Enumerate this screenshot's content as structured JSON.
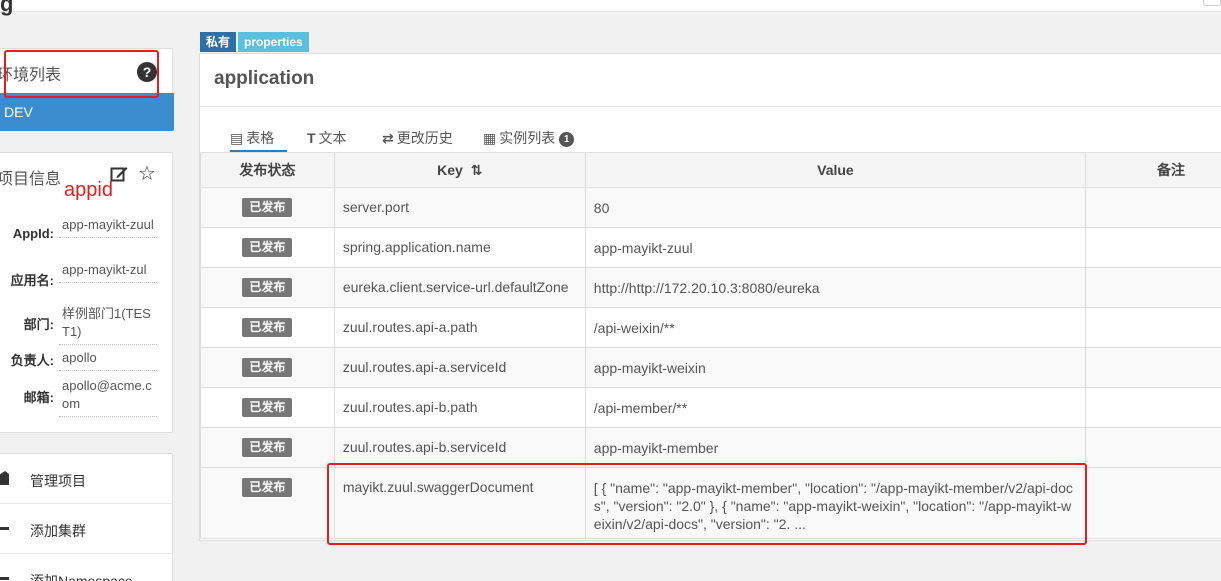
{
  "topbar": {
    "logo_text": "g"
  },
  "env": {
    "title": "环境列表",
    "help_icon": "question-circle-icon",
    "items": [
      {
        "label": "DEV"
      }
    ]
  },
  "project": {
    "title": "项目信息",
    "annotation": "appid",
    "fields": [
      {
        "label": "AppId:",
        "value": "app-mayikt-zuul"
      },
      {
        "label": "应用名:",
        "value": "app-mayikt-zul"
      },
      {
        "label": "部门:",
        "value": "样例部门1(TEST1)"
      },
      {
        "label": "负责人:",
        "value": "apollo"
      },
      {
        "label": "邮箱:",
        "value": "apollo@acme.com"
      }
    ]
  },
  "menu": {
    "items": [
      {
        "label": "管理项目",
        "icon": "manage-icon"
      },
      {
        "label": "添加集群",
        "icon": "add-cluster-icon"
      },
      {
        "label": "添加Namespace",
        "icon": "add-namespace-icon"
      }
    ]
  },
  "namespace": {
    "tags": [
      "私有",
      "properties"
    ],
    "title": "application",
    "tabs": [
      {
        "label": "表格",
        "icon": "table-icon",
        "glyph": "▤"
      },
      {
        "label": "文本",
        "icon": "text-icon",
        "glyph": "T"
      },
      {
        "label": "更改历史",
        "icon": "history-icon",
        "glyph": "⇄"
      },
      {
        "label": "实例列表",
        "icon": "instances-icon",
        "glyph": "▦",
        "badge": "1"
      }
    ],
    "table": {
      "headers": {
        "status": "发布状态",
        "key": "Key",
        "sort_icon": "sort-icon",
        "value": "Value",
        "comment": "备注"
      },
      "rows": [
        {
          "status": "已发布",
          "key": "server.port",
          "value": "80"
        },
        {
          "status": "已发布",
          "key": "spring.application.name",
          "value": "app-mayikt-zuul"
        },
        {
          "status": "已发布",
          "key": "eureka.client.service-url.defaultZone",
          "value": "http://http://172.20.10.3:8080/eureka"
        },
        {
          "status": "已发布",
          "key": "zuul.routes.api-a.path",
          "value": "/api-weixin/**"
        },
        {
          "status": "已发布",
          "key": "zuul.routes.api-a.serviceId",
          "value": "app-mayikt-weixin"
        },
        {
          "status": "已发布",
          "key": "zuul.routes.api-b.path",
          "value": "/api-member/**"
        },
        {
          "status": "已发布",
          "key": "zuul.routes.api-b.serviceId",
          "value": "app-mayikt-member"
        },
        {
          "status": "已发布",
          "key": "mayikt.zuul.swaggerDocument",
          "value": "[ { \"name\": \"app-mayikt-member\", \"location\": \"/app-mayikt-member/v2/api-docs\", \"version\": \"2.0\" }, { \"name\": \"app-mayikt-weixin\", \"location\": \"/app-mayikt-weixin/v2/api-docs\", \"version\": \"2. ..."
        }
      ]
    }
  }
}
